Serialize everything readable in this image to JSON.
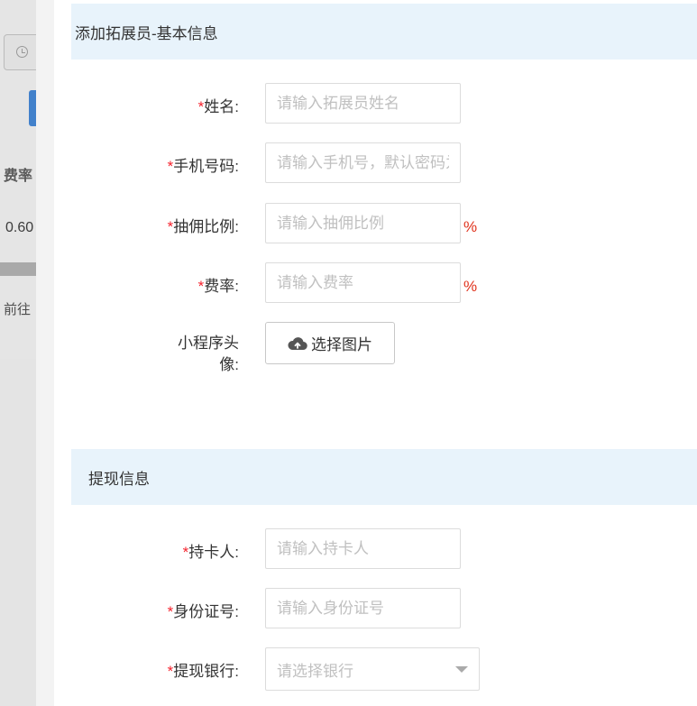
{
  "background": {
    "rate_header": "费率",
    "rate_value": "0.60",
    "goto_label": "前往"
  },
  "drawer": {
    "basic_section_title": "添加拓展员-基本信息",
    "required_mark": "*",
    "fields": {
      "name": {
        "label": "姓名:",
        "placeholder": "请输入拓展员姓名"
      },
      "phone": {
        "label": "手机号码:",
        "placeholder": "请输入手机号，默认密码为"
      },
      "commission": {
        "label": "抽佣比例:",
        "placeholder": "请输入抽佣比例",
        "suffix": "%"
      },
      "rate": {
        "label": "费率:",
        "placeholder": "请输入费率",
        "suffix": "%"
      },
      "avatar": {
        "label_line1": "小程序头",
        "label_line2": "像:",
        "button_label": "选择图片"
      }
    },
    "withdraw_section_title": "提现信息",
    "withdraw_fields": {
      "cardholder": {
        "label": "持卡人:",
        "placeholder": "请输入持卡人"
      },
      "id_number": {
        "label": "身份证号:",
        "placeholder": "请输入身份证号"
      },
      "bank": {
        "label": "提现银行:",
        "placeholder": "请选择银行"
      }
    }
  }
}
